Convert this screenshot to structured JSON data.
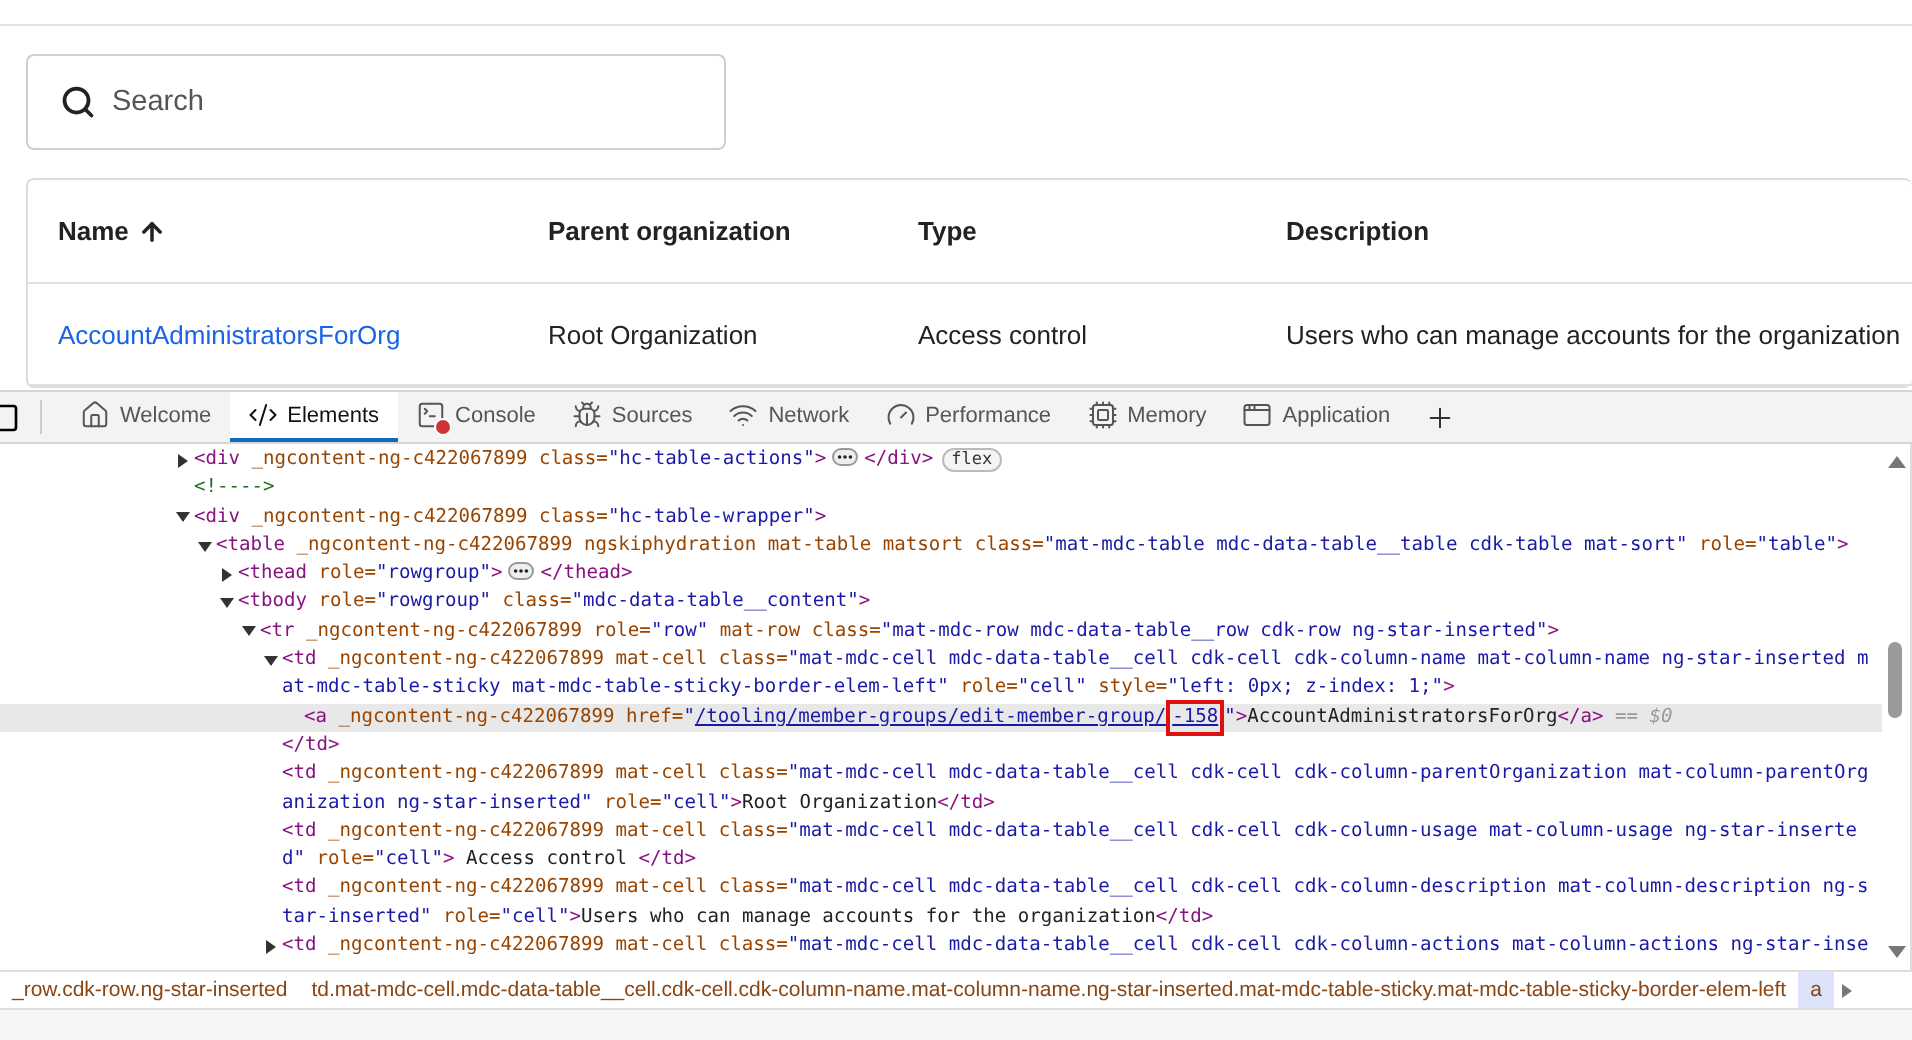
{
  "page": {
    "search": {
      "placeholder": "Search"
    },
    "table": {
      "columns": [
        {
          "label": "Name",
          "sorted": true
        },
        {
          "label": "Parent organization",
          "sorted": false
        },
        {
          "label": "Type",
          "sorted": false
        },
        {
          "label": "Description",
          "sorted": false
        }
      ],
      "rows": [
        {
          "cells": [
            {
              "kind": "link",
              "text": "AccountAdministratorsForOrg"
            },
            {
              "kind": "text",
              "text": "Root Organization"
            },
            {
              "kind": "text",
              "text": "Access control"
            },
            {
              "kind": "text",
              "text": "Users who can manage accounts for the organization"
            }
          ]
        }
      ]
    }
  },
  "devtools": {
    "tabs": [
      {
        "label": "Welcome",
        "selected": false,
        "has_error": false
      },
      {
        "label": "Elements",
        "selected": true,
        "has_error": false
      },
      {
        "label": "Console",
        "selected": false,
        "has_error": true
      },
      {
        "label": "Sources",
        "selected": false,
        "has_error": false
      },
      {
        "label": "Network",
        "selected": false,
        "has_error": false
      },
      {
        "label": "Performance",
        "selected": false,
        "has_error": false
      },
      {
        "label": "Memory",
        "selected": false,
        "has_error": false
      },
      {
        "label": "Application",
        "selected": false,
        "has_error": false
      }
    ],
    "nodes": [
      {
        "expanded": false,
        "selected": false,
        "segments": [
          {
            "kind": "tag",
            "text": "<div"
          },
          {
            "kind": "attr",
            "text": " _ngcontent-ng-c422067899 class="
          },
          {
            "kind": "value",
            "text": "\"hc-table-actions\""
          },
          {
            "kind": "tag",
            "text": ">"
          },
          {
            "kind": "ellipsis"
          },
          {
            "kind": "tag",
            "text": "</div>"
          },
          {
            "kind": "badge",
            "text": "flex"
          }
        ]
      },
      {
        "selected": false,
        "segments": [
          {
            "kind": "comment",
            "text": "<!---->"
          }
        ]
      },
      {
        "expanded": true,
        "selected": false,
        "segments": [
          {
            "kind": "tag",
            "text": "<div"
          },
          {
            "kind": "attr",
            "text": " _ngcontent-ng-c422067899 class="
          },
          {
            "kind": "value",
            "text": "\"hc-table-wrapper\""
          },
          {
            "kind": "tag",
            "text": ">"
          }
        ],
        "children": [
          {
            "expanded": true,
            "selected": false,
            "segments": [
              {
                "kind": "tag",
                "text": "<table"
              },
              {
                "kind": "attr",
                "text": " _ngcontent-ng-c422067899 ngskiphydration mat-table matsort class="
              },
              {
                "kind": "value",
                "text": "\"mat-mdc-table mdc-data-table__table cdk-table mat-sort\""
              },
              {
                "kind": "attr",
                "text": " role="
              },
              {
                "kind": "value",
                "text": "\"table\""
              },
              {
                "kind": "tag",
                "text": ">"
              }
            ],
            "children": [
              {
                "expanded": false,
                "selected": false,
                "segments": [
                  {
                    "kind": "tag",
                    "text": "<thead"
                  },
                  {
                    "kind": "attr",
                    "text": " role="
                  },
                  {
                    "kind": "value",
                    "text": "\"rowgroup\""
                  },
                  {
                    "kind": "tag",
                    "text": ">"
                  },
                  {
                    "kind": "ellipsis"
                  },
                  {
                    "kind": "tag",
                    "text": "</thead>"
                  }
                ]
              },
              {
                "expanded": true,
                "selected": false,
                "segments": [
                  {
                    "kind": "tag",
                    "text": "<tbody"
                  },
                  {
                    "kind": "attr",
                    "text": " role="
                  },
                  {
                    "kind": "value",
                    "text": "\"rowgroup\""
                  },
                  {
                    "kind": "attr",
                    "text": " class="
                  },
                  {
                    "kind": "value",
                    "text": "\"mdc-data-table__content\""
                  },
                  {
                    "kind": "tag",
                    "text": ">"
                  }
                ],
                "children": [
                  {
                    "expanded": true,
                    "selected": false,
                    "segments": [
                      {
                        "kind": "tag",
                        "text": "<tr"
                      },
                      {
                        "kind": "attr",
                        "text": " _ngcontent-ng-c422067899 role="
                      },
                      {
                        "kind": "value",
                        "text": "\"row\""
                      },
                      {
                        "kind": "attr",
                        "text": " mat-row class="
                      },
                      {
                        "kind": "value",
                        "text": "\"mat-mdc-row mdc-data-table__row cdk-row ng-star-inserted\""
                      },
                      {
                        "kind": "tag",
                        "text": ">"
                      }
                    ],
                    "children": [
                      {
                        "expanded": true,
                        "selected": false,
                        "segments": [
                          {
                            "kind": "tag",
                            "text": "<td"
                          },
                          {
                            "kind": "attr",
                            "text": " _ngcontent-ng-c422067899 mat-cell class="
                          },
                          {
                            "kind": "value",
                            "text": "\"mat-mdc-cell mdc-data-table__cell cdk-cell cdk-column-name mat-column-name ng-star-inserted mat-mdc-table-sticky mat-mdc-table-sticky-border-elem-left\""
                          },
                          {
                            "kind": "attr",
                            "text": " role="
                          },
                          {
                            "kind": "value",
                            "text": "\"cell\""
                          },
                          {
                            "kind": "attr",
                            "text": " style="
                          },
                          {
                            "kind": "value",
                            "text": "\"left: 0px; z-index: 1;\""
                          },
                          {
                            "kind": "tag",
                            "text": ">"
                          }
                        ],
                        "close": [
                          {
                            "kind": "tag",
                            "text": "</td>"
                          }
                        ],
                        "children": [
                          {
                            "selected": true,
                            "segments": [
                              {
                                "kind": "tag",
                                "text": "<a"
                              },
                              {
                                "kind": "attr",
                                "text": " _ngcontent-ng-c422067899 href="
                              },
                              {
                                "kind": "value",
                                "text": "\""
                              },
                              {
                                "kind": "link",
                                "text": "/tooling/member-groups/edit-member-group/"
                              },
                              {
                                "kind": "boxed-link",
                                "text": "-158"
                              },
                              {
                                "kind": "value",
                                "text": "\""
                              },
                              {
                                "kind": "tag",
                                "text": ">"
                              },
                              {
                                "kind": "text",
                                "text": "AccountAdministratorsForOrg"
                              },
                              {
                                "kind": "tag",
                                "text": "</a>"
                              },
                              {
                                "kind": "marker",
                                "text": " == $0"
                              }
                            ]
                          }
                        ]
                      },
                      {
                        "selected": false,
                        "segments": [
                          {
                            "kind": "tag",
                            "text": "<td"
                          },
                          {
                            "kind": "attr",
                            "text": " _ngcontent-ng-c422067899 mat-cell class="
                          },
                          {
                            "kind": "value",
                            "text": "\"mat-mdc-cell mdc-data-table__cell cdk-cell cdk-column-parentOrganization mat-column-parentOrganization ng-star-inserted\""
                          },
                          {
                            "kind": "attr",
                            "text": " role="
                          },
                          {
                            "kind": "value",
                            "text": "\"cell\""
                          },
                          {
                            "kind": "tag",
                            "text": ">"
                          },
                          {
                            "kind": "text",
                            "text": "Root Organization"
                          },
                          {
                            "kind": "tag",
                            "text": "</td>"
                          }
                        ]
                      },
                      {
                        "selected": false,
                        "segments": [
                          {
                            "kind": "tag",
                            "text": "<td"
                          },
                          {
                            "kind": "attr",
                            "text": " _ngcontent-ng-c422067899 mat-cell class="
                          },
                          {
                            "kind": "value",
                            "text": "\"mat-mdc-cell mdc-data-table__cell cdk-cell cdk-column-usage mat-column-usage ng-star-inserted\""
                          },
                          {
                            "kind": "attr",
                            "text": " role="
                          },
                          {
                            "kind": "value",
                            "text": "\"cell\""
                          },
                          {
                            "kind": "tag",
                            "text": ">"
                          },
                          {
                            "kind": "text",
                            "text": " Access control "
                          },
                          {
                            "kind": "tag",
                            "text": "</td>"
                          }
                        ]
                      },
                      {
                        "selected": false,
                        "segments": [
                          {
                            "kind": "tag",
                            "text": "<td"
                          },
                          {
                            "kind": "attr",
                            "text": " _ngcontent-ng-c422067899 mat-cell class="
                          },
                          {
                            "kind": "value",
                            "text": "\"mat-mdc-cell mdc-data-table__cell cdk-cell cdk-column-description mat-column-description ng-star-inserted\""
                          },
                          {
                            "kind": "attr",
                            "text": " role="
                          },
                          {
                            "kind": "value",
                            "text": "\"cell\""
                          },
                          {
                            "kind": "tag",
                            "text": ">"
                          },
                          {
                            "kind": "text",
                            "text": "Users who can manage accounts for the organization"
                          },
                          {
                            "kind": "tag",
                            "text": "</td>"
                          }
                        ]
                      },
                      {
                        "expanded": false,
                        "selected": false,
                        "segments": [
                          {
                            "kind": "tag",
                            "text": "<td"
                          },
                          {
                            "kind": "attr",
                            "text": " _ngcontent-ng-c422067899 mat-cell class="
                          },
                          {
                            "kind": "value",
                            "text": "\"mat-mdc-cell mdc-data-table__cell cdk-cell cdk-column-actions mat-column-actions ng-star-inse"
                          }
                        ]
                      }
                    ]
                  }
                ]
              }
            ]
          }
        ]
      }
    ],
    "breadcrumbs": [
      {
        "label": "_row.cdk-row.ng-star-inserted",
        "selected": false
      },
      {
        "label": "td.mat-mdc-cell.mdc-data-table__cell.cdk-cell.cdk-column-name.mat-column-name.ng-star-inserted.mat-mdc-table-sticky.mat-mdc-table-sticky-border-elem-left",
        "selected": false
      },
      {
        "label": "a",
        "selected": true
      }
    ]
  }
}
